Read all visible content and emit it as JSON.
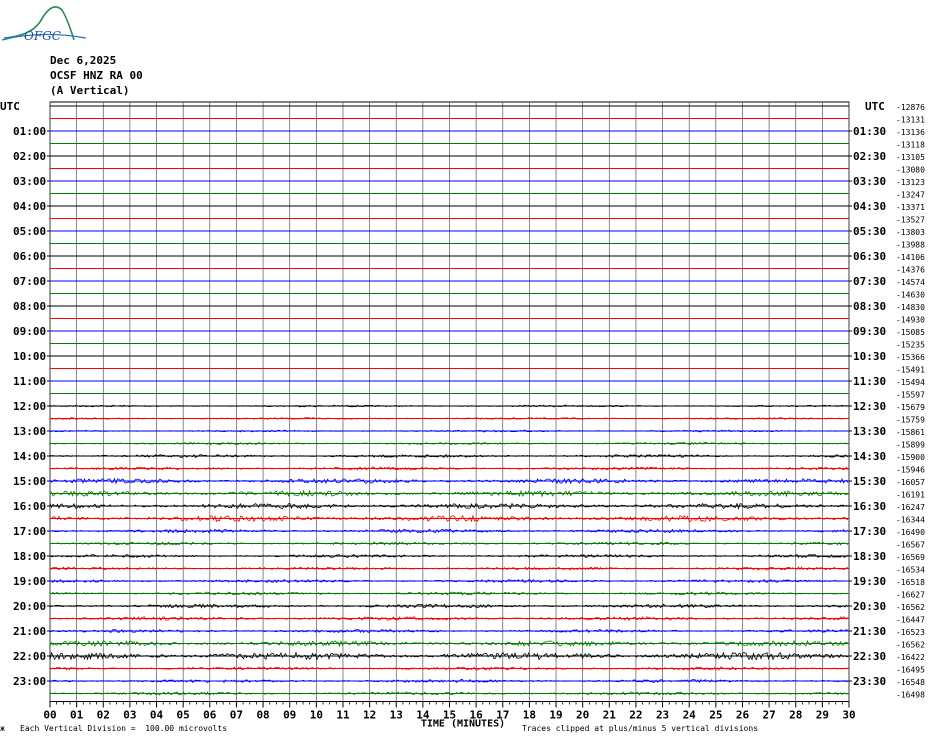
{
  "logo": {
    "text": "OFGC"
  },
  "header": {
    "date": "Dec 6,2025",
    "station": "OCSF HNZ RA 00",
    "component": "(A Vertical)"
  },
  "footer": {
    "scale_note": "Each Vertical Division =  100.00 microvolts",
    "clip_note": "Traces clipped at plus/minus 5 vertical divisions",
    "mark": "ж"
  },
  "chart_data": {
    "type": "line",
    "title": "",
    "xlabel": "TIME (MINUTES)",
    "ylabel": "",
    "xlim": [
      0,
      30
    ],
    "x_ticks": [
      "00",
      "01",
      "02",
      "03",
      "04",
      "05",
      "06",
      "07",
      "08",
      "09",
      "10",
      "11",
      "12",
      "13",
      "14",
      "15",
      "16",
      "17",
      "18",
      "19",
      "20",
      "21",
      "22",
      "23",
      "24",
      "25",
      "26",
      "27",
      "28",
      "29",
      "30"
    ],
    "left_axis_title": "UTC",
    "right_axis_title": "UTC",
    "left_hour_labels": [
      "01:00",
      "02:00",
      "03:00",
      "04:00",
      "05:00",
      "06:00",
      "07:00",
      "08:00",
      "09:00",
      "10:00",
      "11:00",
      "12:00",
      "13:00",
      "14:00",
      "15:00",
      "16:00",
      "17:00",
      "18:00",
      "19:00",
      "20:00",
      "21:00",
      "22:00",
      "23:00"
    ],
    "right_hour_labels": [
      "01:30",
      "02:30",
      "03:30",
      "04:30",
      "05:30",
      "06:30",
      "07:30",
      "08:30",
      "09:30",
      "10:30",
      "11:30",
      "12:30",
      "13:30",
      "14:30",
      "15:30",
      "16:30",
      "17:30",
      "18:30",
      "19:30",
      "20:30",
      "21:30",
      "22:30",
      "23:30"
    ],
    "trace_offsets": [
      "-12876",
      "-13131",
      "-13136",
      "-13118",
      "-13105",
      "-13080",
      "-13123",
      "-13247",
      "-13371",
      "-13527",
      "-13803",
      "-13988",
      "-14106",
      "-14376",
      "-14574",
      "-14630",
      "-14830",
      "-14930",
      "-15085",
      "-15235",
      "-15366",
      "-15491",
      "-15494",
      "-15597",
      "-15679",
      "-15759",
      "-15861",
      "-15899",
      "-15900",
      "-15946",
      "-16057",
      "-16191",
      "-16247",
      "-16344",
      "-16490",
      "-16567",
      "-16569",
      "-16534",
      "-16518",
      "-16627",
      "-16562",
      "-16447",
      "-16523",
      "-16562",
      "-16422",
      "-16495",
      "-16548",
      "-16498"
    ],
    "trace_colors": [
      "#000000",
      "#ff0000",
      "#0000ff",
      "#007f00"
    ],
    "trace_amplitude": [
      0.3,
      0.3,
      0.3,
      0.3,
      0.3,
      0.3,
      0.3,
      0.3,
      0.3,
      0.3,
      0.3,
      0.3,
      0.3,
      0.3,
      0.3,
      0.3,
      0.3,
      0.3,
      0.3,
      0.3,
      0.3,
      0.3,
      0.3,
      0.3,
      0.6,
      0.6,
      0.6,
      0.7,
      1.0,
      1.0,
      1.6,
      1.8,
      1.8,
      2.0,
      1.2,
      1.0,
      1.0,
      1.0,
      1.0,
      1.0,
      1.2,
      1.2,
      1.0,
      1.8,
      2.4,
      1.0,
      1.0,
      1.0
    ],
    "vertical_division": "100.00 microvolts",
    "clip": "plus/minus 5 vertical divisions"
  }
}
